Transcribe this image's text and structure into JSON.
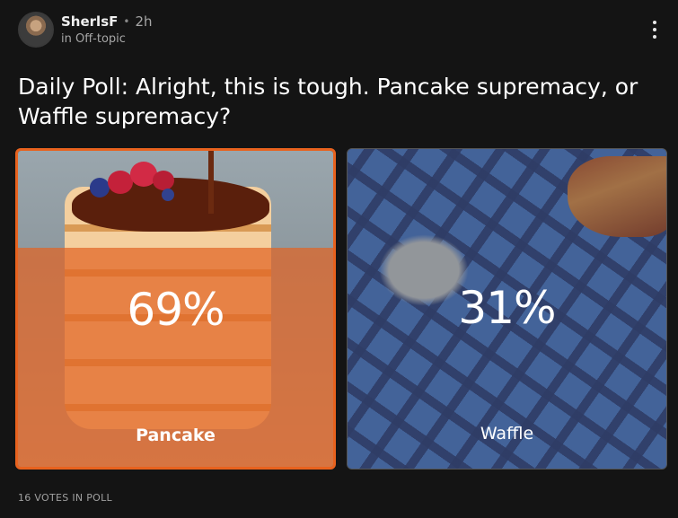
{
  "post": {
    "username": "SherlsF",
    "time": "2h",
    "community": "in Off-topic",
    "question": "Daily Poll: Alright, this is tough. Pancake supremacy, or Waffle supremacy?"
  },
  "poll": {
    "options": [
      {
        "label": "Pancake",
        "percent_text": "69%",
        "percent": 69,
        "selected": true
      },
      {
        "label": "Waffle",
        "percent_text": "31%",
        "percent": 31,
        "selected": false
      }
    ],
    "votes_text": "16 VOTES IN POLL"
  },
  "colors": {
    "background": "#141414",
    "accent": "#e8621e"
  },
  "icons": {
    "more": "vertical-dots-icon"
  }
}
